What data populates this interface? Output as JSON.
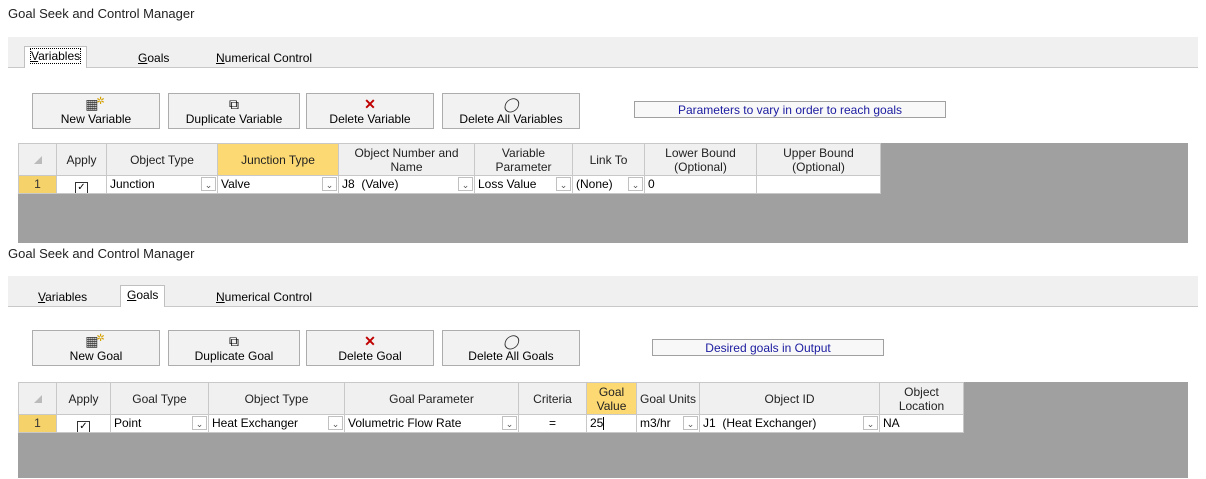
{
  "dialog1": {
    "title": "Goal Seek and Control Manager",
    "tabs": [
      {
        "pre": "",
        "ul": "V",
        "post": "ariables"
      },
      {
        "pre": "",
        "ul": "G",
        "post": "oals"
      },
      {
        "pre": "",
        "ul": "N",
        "post": "umerical Control"
      }
    ],
    "toolbar": {
      "new": "New Variable",
      "duplicate": "Duplicate Variable",
      "delete": "Delete Variable",
      "delete_all": "Delete All Variables"
    },
    "info": "Parameters to vary in order to reach goals",
    "columns": [
      "Apply",
      "Object Type",
      "Junction Type",
      "Object Number and Name",
      "Variable Parameter",
      "Link To",
      "Lower Bound (Optional)",
      "Upper Bound (Optional)"
    ],
    "rows": [
      {
        "num": "1",
        "apply": "✓",
        "object_type": "Junction",
        "junction_type": "Valve",
        "object": "J8  (Valve)",
        "parameter": "Loss Value",
        "link_to": "(None)",
        "lower": "0",
        "upper": ""
      }
    ]
  },
  "dialog2": {
    "title": "Goal Seek and Control Manager",
    "tabs": [
      {
        "pre": "",
        "ul": "V",
        "post": "ariables"
      },
      {
        "pre": "",
        "ul": "G",
        "post": "oals"
      },
      {
        "pre": "",
        "ul": "N",
        "post": "umerical Control"
      }
    ],
    "toolbar": {
      "new": "New Goal",
      "duplicate": "Duplicate Goal",
      "delete": "Delete Goal",
      "delete_all": "Delete All Goals"
    },
    "info": "Desired goals in Output",
    "columns": [
      "Apply",
      "Goal Type",
      "Object Type",
      "Goal Parameter",
      "Criteria",
      "Goal Value",
      "Goal Units",
      "Object ID",
      "Object Location"
    ],
    "rows": [
      {
        "num": "1",
        "apply": "✓",
        "goal_type": "Point",
        "object_type": "Heat Exchanger",
        "parameter": "Volumetric Flow Rate",
        "criteria": "=",
        "value": "25",
        "units": "m3/hr",
        "object_id": "J1  (Heat Exchanger)",
        "location": "NA"
      }
    ]
  },
  "icons": {
    "new": "new-item-icon",
    "duplicate": "duplicate-icon",
    "delete": "delete-x-icon",
    "delete_all": "eraser-icon",
    "dropdown": "chevron-down-icon"
  },
  "colors": {
    "highlight_header": "#fcd972",
    "row_number": "#f5d26a",
    "info_text": "#1a1aa0",
    "delete_icon": "#c00000"
  }
}
